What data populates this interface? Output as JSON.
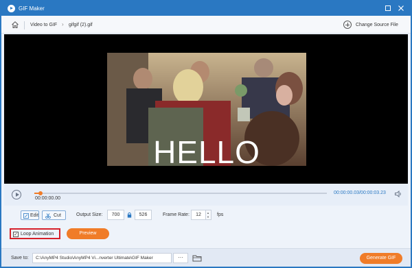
{
  "app": {
    "title": "GIF Maker"
  },
  "breadcrumb": {
    "home_icon": "home-icon",
    "items": [
      "Video to GIF",
      "gifgif (2).gif"
    ],
    "change_source": "Change Source File"
  },
  "preview": {
    "caption": "HELLO"
  },
  "playback": {
    "current_time": "00:00:00.00",
    "time_display": "00:00:00.03/00:00:03.23",
    "progress_fraction": 0.02,
    "accent": "#f07c28"
  },
  "tools": {
    "edit": "Edit",
    "cut": "Cut"
  },
  "output": {
    "label": "Output Size:",
    "width": "700",
    "height": "526"
  },
  "frame_rate": {
    "label": "Frame Rate:",
    "value": "12",
    "unit": "fps"
  },
  "loop": {
    "label": "Loop Animation",
    "checked": true
  },
  "preview_button": "Preview",
  "save": {
    "label": "Save to:",
    "path": "C:\\AnyMP4 Studio\\AnyMP4 Vi...nverter Ultimate\\GIF Maker",
    "more": "···"
  },
  "generate_button": "Generate GIF",
  "colors": {
    "title_bar": "#2a78c2",
    "highlight": "#d6202a"
  }
}
